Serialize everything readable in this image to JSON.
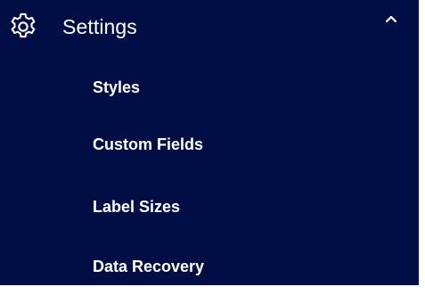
{
  "section": {
    "label": "Settings",
    "icon": "gear-icon",
    "toggle_icon": "chevron-up-icon",
    "expanded": true
  },
  "items": [
    {
      "label": "Styles"
    },
    {
      "label": "Custom Fields"
    },
    {
      "label": "Label Sizes"
    },
    {
      "label": "Data Recovery"
    }
  ],
  "colors": {
    "background": "#010d45",
    "text": "#ffffff"
  }
}
